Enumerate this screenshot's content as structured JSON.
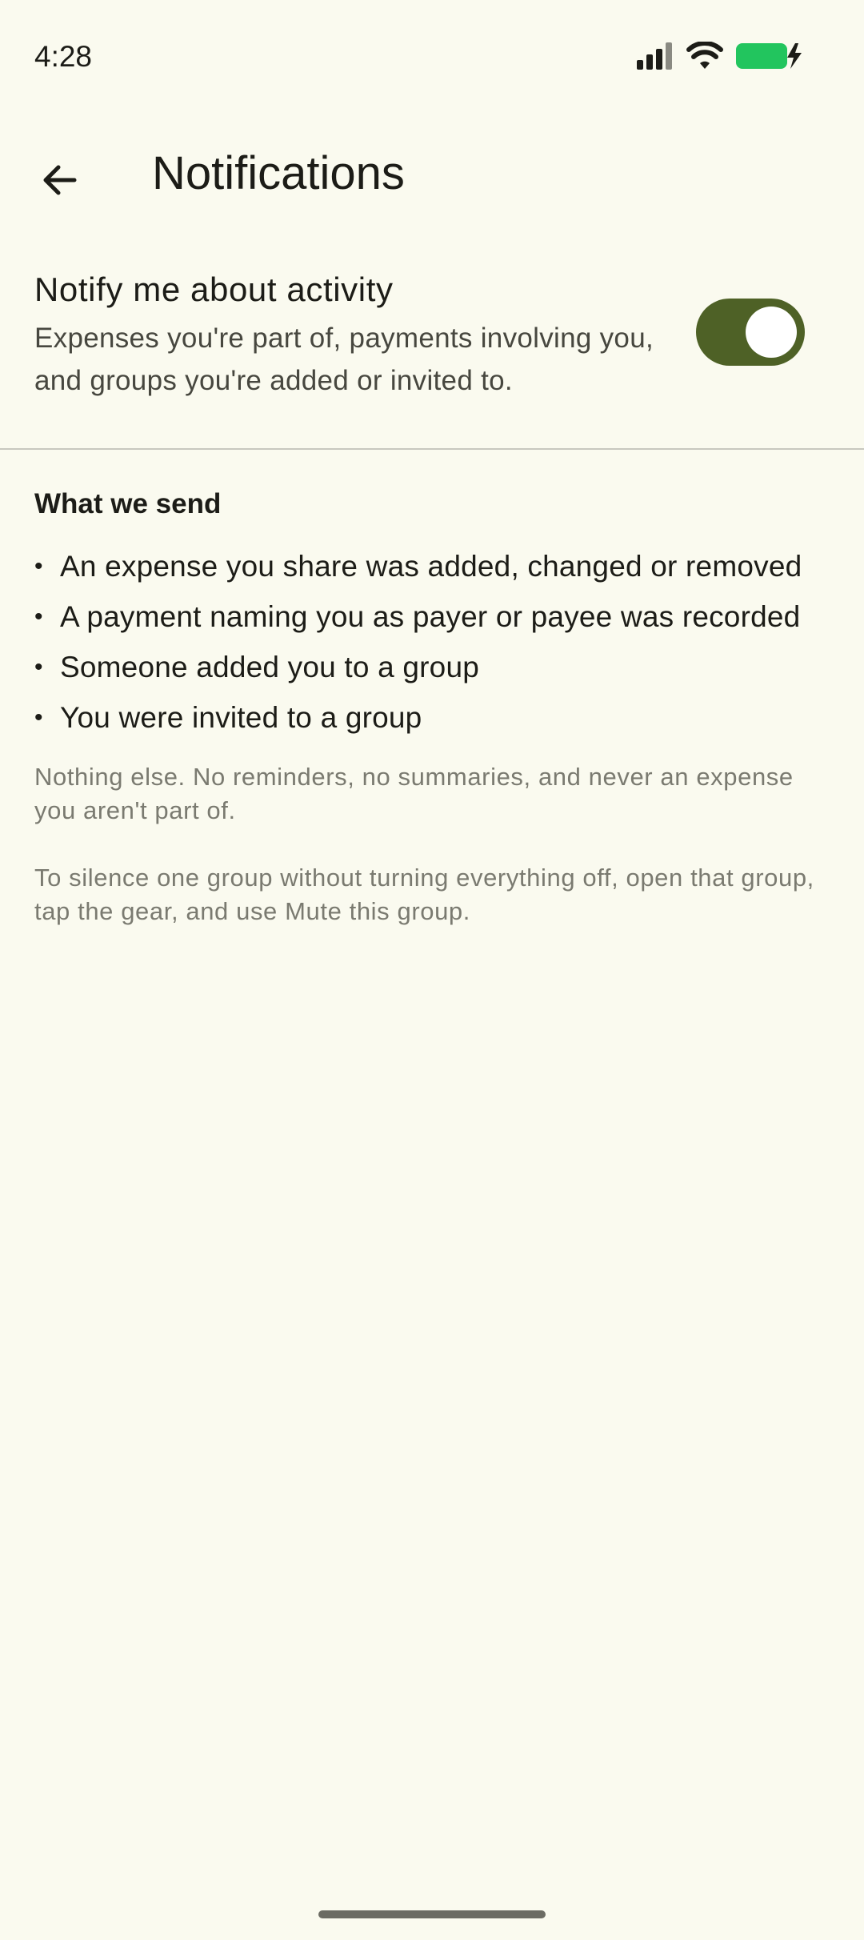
{
  "status_bar": {
    "time": "4:28",
    "icons": [
      "signal-icon",
      "wifi-icon",
      "battery-charging-icon"
    ],
    "battery_color": "#22C55E"
  },
  "app_bar": {
    "back_icon": "arrow-back-icon",
    "title": "Notifications"
  },
  "activity_toggle": {
    "title": "Notify me about activity",
    "subtitle": "Expenses you're part of, payments involving you, and groups you're added or invited to.",
    "enabled": true,
    "accent_color": "#4E6126"
  },
  "what_we_send": {
    "heading": "What we send",
    "items": [
      "An expense you share was added, changed or removed",
      "A payment naming you as payer or payee was recorded",
      "Someone added you to a group",
      "You were invited to a group"
    ],
    "note_1": "Nothing else. No reminders, no summaries, and never an expense you aren't part of.",
    "note_2": "To silence one group without turning everything off, open that group, tap the gear, and use Mute this group."
  }
}
